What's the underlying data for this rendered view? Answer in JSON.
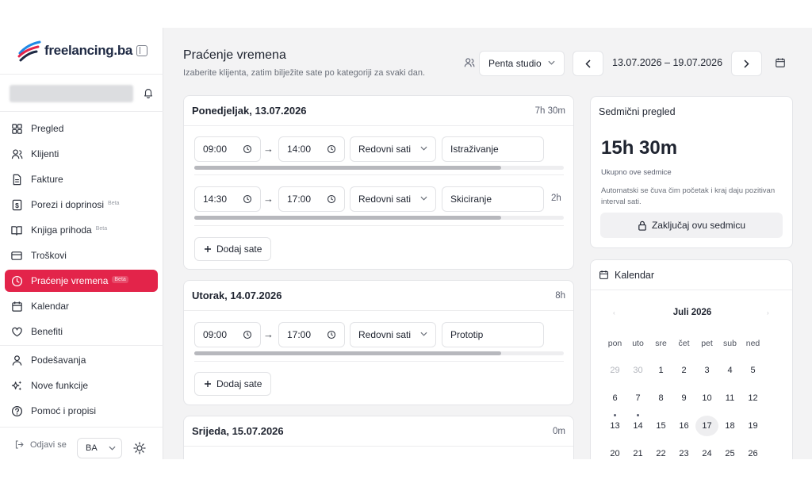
{
  "brand": {
    "name": "freelancing.ba",
    "accent": "#e3244a"
  },
  "sidebar": {
    "items": [
      {
        "label": "Pregled",
        "icon": "grid-icon"
      },
      {
        "label": "Klijenti",
        "icon": "users-icon"
      },
      {
        "label": "Fakture",
        "icon": "file-icon"
      },
      {
        "label": "Porezi i doprinosi",
        "icon": "dollar-doc-icon",
        "badge": "Beta"
      },
      {
        "label": "Knjiga prihoda",
        "icon": "book-icon",
        "badge": "Beta"
      },
      {
        "label": "Troškovi",
        "icon": "credit-card-icon"
      },
      {
        "label": "Praćenje vremena",
        "icon": "clock-icon",
        "badge": "Beta",
        "active": true
      },
      {
        "label": "Kalendar",
        "icon": "calendar-icon"
      },
      {
        "label": "Benefiti",
        "icon": "heart-icon"
      },
      {
        "label": "Podešavanja",
        "icon": "user-icon"
      },
      {
        "label": "Nove funkcije",
        "icon": "sparkles-icon"
      },
      {
        "label": "Pomoć i propisi",
        "icon": "help-icon"
      }
    ],
    "logout": "Odjavi se",
    "language": "BA"
  },
  "header": {
    "title": "Praćenje vremena",
    "subtitle": "Izaberite klijenta, zatim bilježite sate po kategoriji za svaki dan.",
    "client": "Penta studio",
    "date_range": "13.07.2026 – 19.07.2026"
  },
  "days": [
    {
      "title": "Ponedjeljak, 13.07.2026",
      "total": "7h 30m",
      "entries": [
        {
          "start": "09:00",
          "end": "14:00",
          "category": "Redovni sati",
          "task": "Istraživanje",
          "duration": "",
          "fill": 0.83
        },
        {
          "start": "14:30",
          "end": "17:00",
          "category": "Redovni sati",
          "task": "Skiciranje",
          "duration": "2h",
          "fill": 0.83
        }
      ],
      "add_label": "Dodaj sate"
    },
    {
      "title": "Utorak, 14.07.2026",
      "total": "8h",
      "entries": [
        {
          "start": "09:00",
          "end": "17:00",
          "category": "Redovni sati",
          "task": "Prototip",
          "duration": "",
          "fill": 0.83
        }
      ],
      "add_label": "Dodaj sate"
    },
    {
      "title": "Srijeda, 15.07.2026",
      "total": "0m"
    }
  ],
  "week_summary": {
    "title": "Sedmični pregled",
    "total": "15h 30m",
    "total_label": "Ukupno ove sedmice",
    "note": "Automatski se čuva čim početak i kraj daju pozitivan interval sati.",
    "lock_label": "Zaključaj ovu sedmicu"
  },
  "calendar": {
    "title": "Kalendar",
    "month": "Juli 2026",
    "weekdays": [
      "pon",
      "uto",
      "sre",
      "čet",
      "pet",
      "sub",
      "ned"
    ],
    "weeks": [
      [
        "29",
        "30",
        "1",
        "2",
        "3",
        "4",
        "5"
      ],
      [
        "6",
        "7",
        "8",
        "9",
        "10",
        "11",
        "12"
      ],
      [
        "13",
        "14",
        "15",
        "16",
        "17",
        "18",
        "19"
      ],
      [
        "20",
        "21",
        "22",
        "23",
        "24",
        "25",
        "26"
      ]
    ],
    "muted": [
      "29",
      "30"
    ],
    "selected": "17",
    "dotted": [
      "13",
      "14"
    ]
  }
}
